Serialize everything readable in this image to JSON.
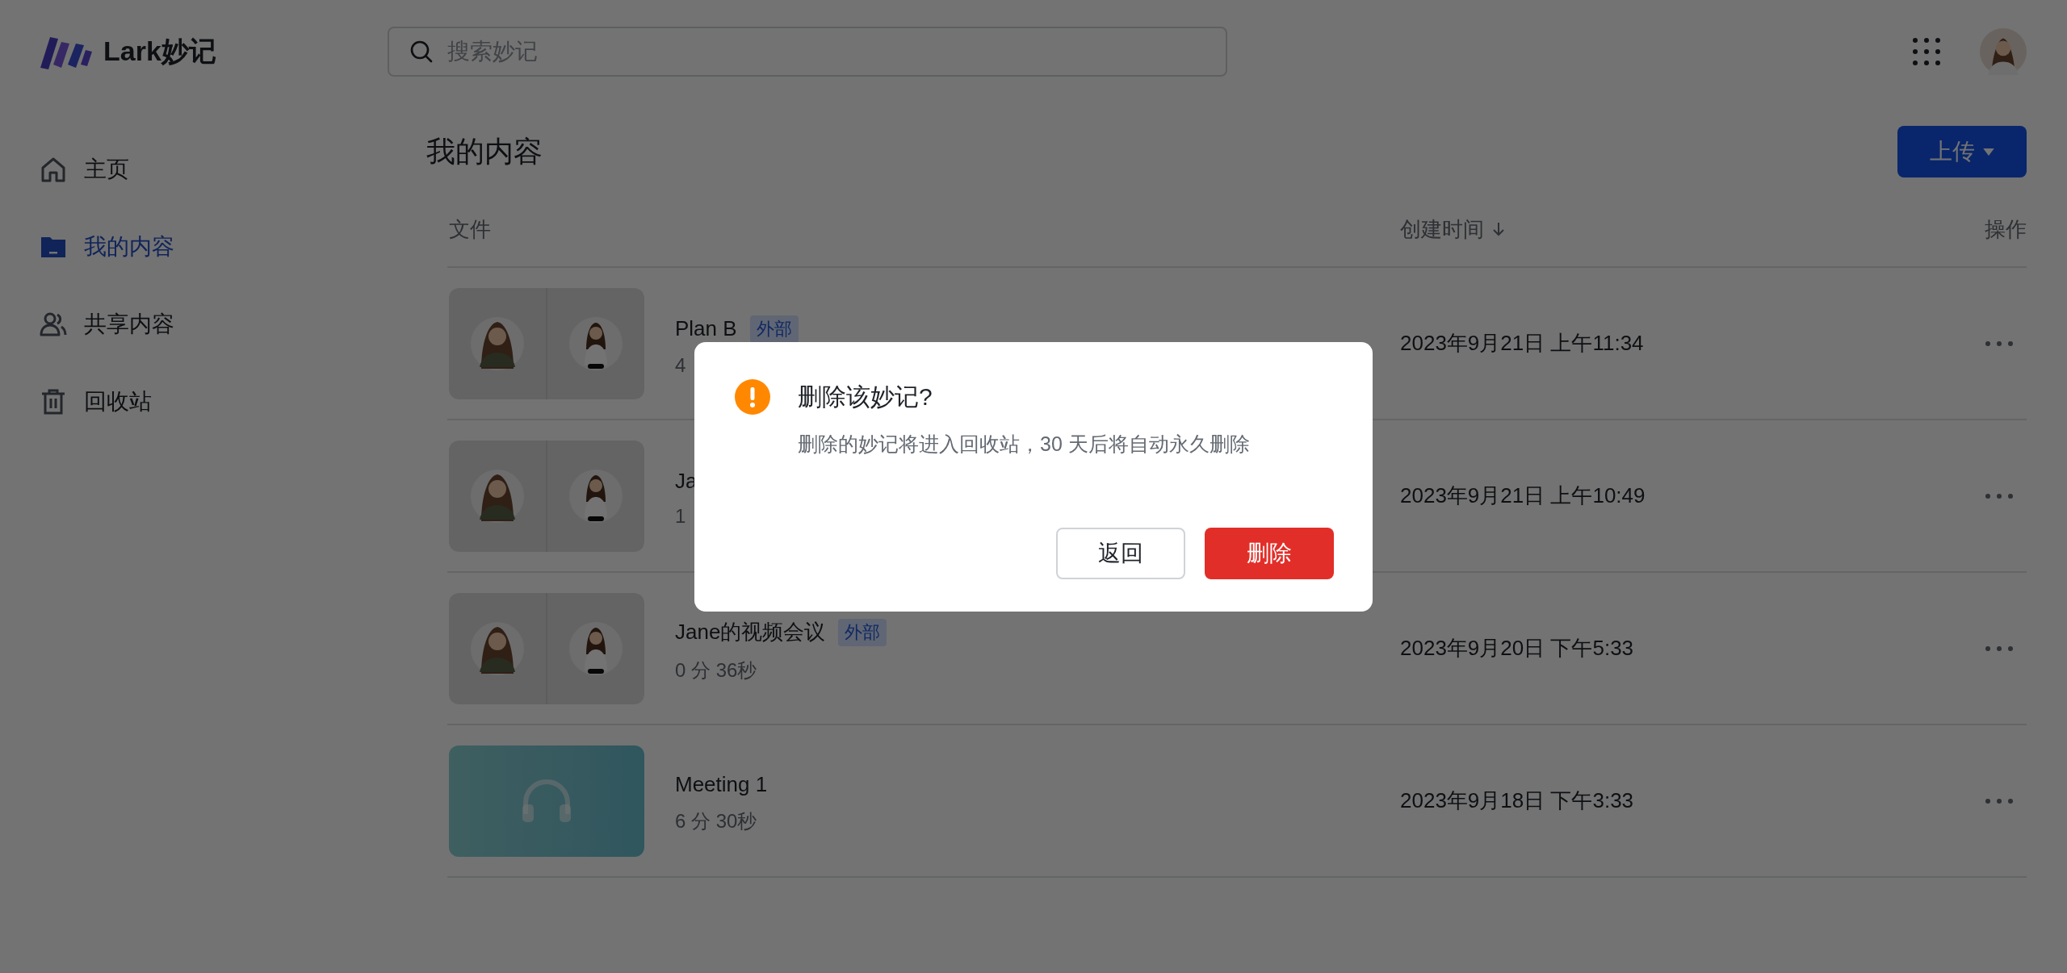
{
  "app": {
    "name": "Lark妙记"
  },
  "search": {
    "placeholder": "搜索妙记"
  },
  "sidebar": {
    "items": [
      {
        "label": "主页",
        "kind": "home",
        "selected": false
      },
      {
        "label": "我的内容",
        "kind": "folder",
        "selected": true
      },
      {
        "label": "共享内容",
        "kind": "people",
        "selected": false
      },
      {
        "label": "回收站",
        "kind": "trash",
        "selected": false
      }
    ]
  },
  "content": {
    "title": "我的内容",
    "upload_button": "上传",
    "columns": [
      {
        "label": "文件",
        "sorted": false
      },
      {
        "label": "创建时间",
        "sorted": true
      },
      {
        "label": "操作",
        "sorted": false
      }
    ],
    "rows": [
      {
        "title": "Plan B",
        "tag": "外部",
        "duration": "4",
        "created": "2023年9月21日 上午11:34",
        "kind": "video"
      },
      {
        "title": "Ja",
        "duration": "1",
        "created": "2023年9月21日 上午10:49",
        "kind": "video"
      },
      {
        "title": "Jane的视频会议",
        "tag": "外部",
        "duration": "0 分 36秒",
        "created": "2023年9月20日 下午5:33",
        "kind": "video"
      },
      {
        "title": "Meeting 1",
        "duration": "6 分 30秒",
        "created": "2023年9月18日 下午3:33",
        "kind": "audio"
      }
    ]
  },
  "dialog": {
    "title": "删除该妙记?",
    "message": "删除的妙记将进入回收站，30 天后将自动永久删除",
    "cancel": "返回",
    "confirm": "删除"
  }
}
